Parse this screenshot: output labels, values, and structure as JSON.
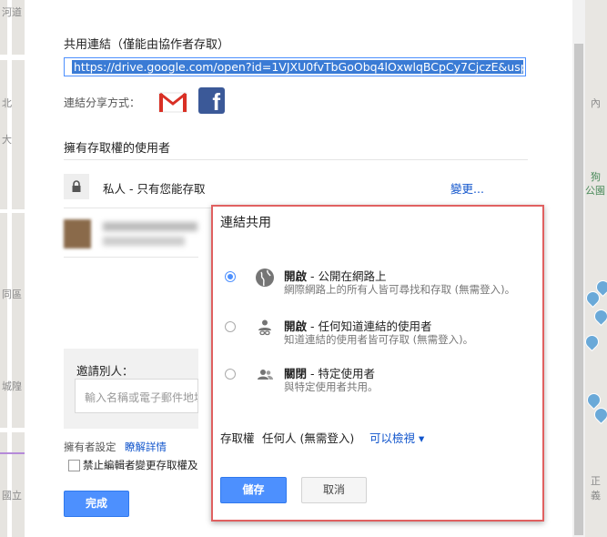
{
  "map": {
    "left_labels": [
      "河道",
      "北",
      "大",
      "同區",
      "城隍",
      "國立"
    ],
    "right_labels": [
      "內",
      "狗",
      "公園",
      "正義"
    ]
  },
  "dialog": {
    "title": "共用連結（僅能由協作者存取）",
    "share_url": "https://drive.google.com/open?id=1VJXU0fvTbGoObq4lOxwlqBCpCy7CjczE&usp=sha",
    "share_via_label": "連結分享方式：",
    "gmail_icon": "gmail-icon",
    "facebook_icon": "facebook-icon",
    "facebook_glyph": "f",
    "access_title": "擁有存取權的使用者",
    "private_text": "私人 - 只有您能存取",
    "change_link": "變更...",
    "invite_label": "邀請別人：",
    "invite_placeholder": "輸入名稱或電子郵件地址",
    "owner_settings": "擁有者設定",
    "learn_more": "瞭解詳情",
    "checkbox_label": "禁止編輯者變更存取權及",
    "done_button": "完成"
  },
  "popup": {
    "title": "連結共用",
    "options": [
      {
        "state": "開啟",
        "title_rest": " - 公開在網路上",
        "desc": "網際網路上的所有人皆可尋找和存取 (無需登入)。",
        "icon": "globe-icon",
        "selected": true
      },
      {
        "state": "開啟",
        "title_rest": " - 任何知道連結的使用者",
        "desc": "知道連結的使用者皆可存取 (無需登入)。",
        "icon": "person-link-icon",
        "selected": false
      },
      {
        "state": "關閉",
        "title_rest": " - 特定使用者",
        "desc": "與特定使用者共用。",
        "icon": "people-icon",
        "selected": false
      }
    ],
    "permission_label": "存取權",
    "permission_who": "任何人 (無需登入)",
    "permission_level": "可以檢視 ▾",
    "save_button": "儲存",
    "cancel_button": "取消"
  },
  "colors": {
    "accent": "#4d90fe",
    "link": "#1155cc",
    "highlight_border": "#e06060",
    "facebook": "#3b5998"
  }
}
